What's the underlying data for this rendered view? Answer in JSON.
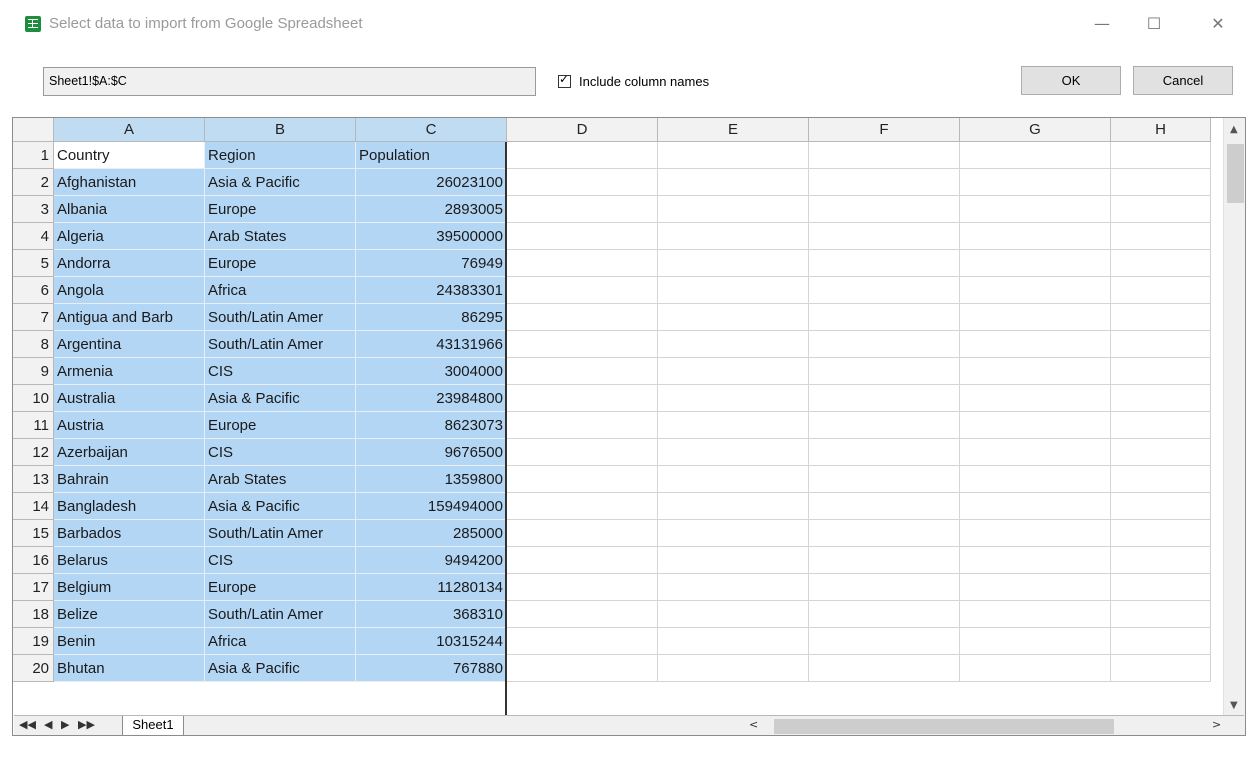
{
  "window": {
    "title": "Select data to import from Google Spreadsheet",
    "icon": "sheets-icon",
    "minimize": "—",
    "maximize": "☐",
    "close": "✕"
  },
  "toolbar": {
    "range_value": "Sheet1!$A:$C",
    "include_checked": true,
    "include_label": "Include column names",
    "ok_label": "OK",
    "cancel_label": "Cancel"
  },
  "grid": {
    "columns": [
      "A",
      "B",
      "C",
      "D",
      "E",
      "F",
      "G",
      "H"
    ],
    "rows": [
      {
        "n": "1",
        "a": "Country",
        "b": "Region",
        "c": "Population"
      },
      {
        "n": "2",
        "a": "Afghanistan",
        "b": "Asia & Pacific",
        "c": "26023100"
      },
      {
        "n": "3",
        "a": "Albania",
        "b": "Europe",
        "c": "2893005"
      },
      {
        "n": "4",
        "a": "Algeria",
        "b": "Arab States",
        "c": "39500000"
      },
      {
        "n": "5",
        "a": "Andorra",
        "b": "Europe",
        "c": "76949"
      },
      {
        "n": "6",
        "a": "Angola",
        "b": "Africa",
        "c": "24383301"
      },
      {
        "n": "7",
        "a": "Antigua and Barb",
        "b": "South/Latin Amer",
        "c": "86295"
      },
      {
        "n": "8",
        "a": "Argentina",
        "b": "South/Latin Amer",
        "c": "43131966"
      },
      {
        "n": "9",
        "a": "Armenia",
        "b": "CIS",
        "c": "3004000"
      },
      {
        "n": "10",
        "a": "Australia",
        "b": "Asia & Pacific",
        "c": "23984800"
      },
      {
        "n": "11",
        "a": "Austria",
        "b": "Europe",
        "c": "8623073"
      },
      {
        "n": "12",
        "a": "Azerbaijan",
        "b": "CIS",
        "c": "9676500"
      },
      {
        "n": "13",
        "a": "Bahrain",
        "b": "Arab States",
        "c": "1359800"
      },
      {
        "n": "14",
        "a": "Bangladesh",
        "b": "Asia & Pacific",
        "c": "159494000"
      },
      {
        "n": "15",
        "a": "Barbados",
        "b": "South/Latin Amer",
        "c": "285000"
      },
      {
        "n": "16",
        "a": "Belarus",
        "b": "CIS",
        "c": "9494200"
      },
      {
        "n": "17",
        "a": "Belgium",
        "b": "Europe",
        "c": "11280134"
      },
      {
        "n": "18",
        "a": "Belize",
        "b": "South/Latin Amer",
        "c": "368310"
      },
      {
        "n": "19",
        "a": "Benin",
        "b": "Africa",
        "c": "10315244"
      },
      {
        "n": "20",
        "a": "Bhutan",
        "b": "Asia & Pacific",
        "c": "767880"
      }
    ],
    "selection_color": "#b4d6f5",
    "header_selected_color": "#c0dcf3"
  },
  "footer": {
    "nav_first": "◀◀",
    "nav_prev": "◀",
    "nav_next": "▶",
    "nav_last": "▶▶",
    "sheet_tab": "Sheet1",
    "scroll_left": "<",
    "scroll_right": ">"
  }
}
